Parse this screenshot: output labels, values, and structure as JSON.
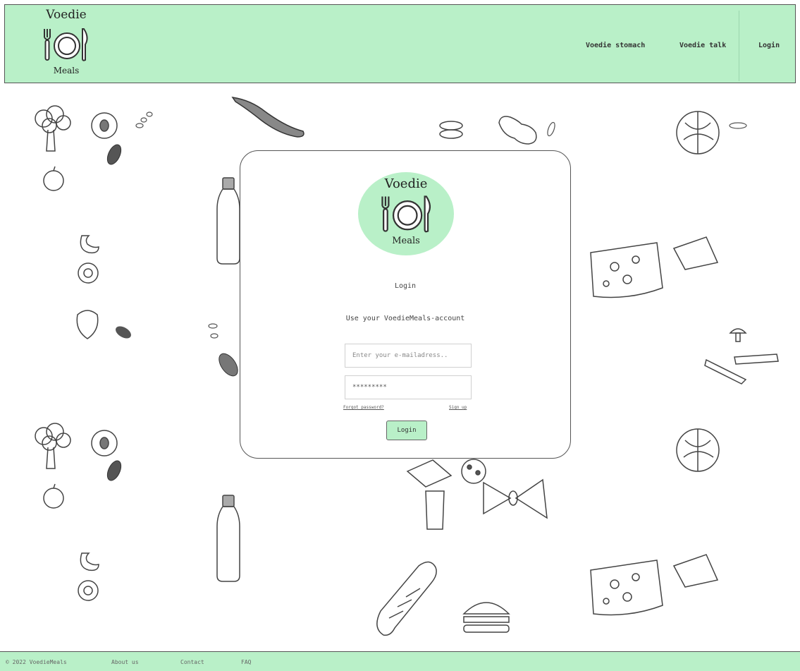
{
  "brand": {
    "line1": "Voedie",
    "line2": "Meals"
  },
  "nav": [
    {
      "label": "Voedie stomach"
    },
    {
      "label": "Voedie talk"
    },
    {
      "label": "Login"
    }
  ],
  "login": {
    "title": "Login",
    "subtitle": "Use your VoedieMeals-account",
    "email_placeholder": "Enter your e-mailadress..",
    "password_value": "*********",
    "forgot_label": "Forgot password?",
    "signup_label": "Sign up",
    "button_label": "Login"
  },
  "footer": {
    "copyright": "© 2022 VoedieMeals",
    "links": [
      {
        "label": "About us"
      },
      {
        "label": "Contact"
      },
      {
        "label": "FAQ"
      }
    ]
  },
  "colors": {
    "accent": "#b9f0c8",
    "border": "#555555"
  },
  "icons": [
    "fork-icon",
    "plate-icon",
    "knife-icon"
  ]
}
